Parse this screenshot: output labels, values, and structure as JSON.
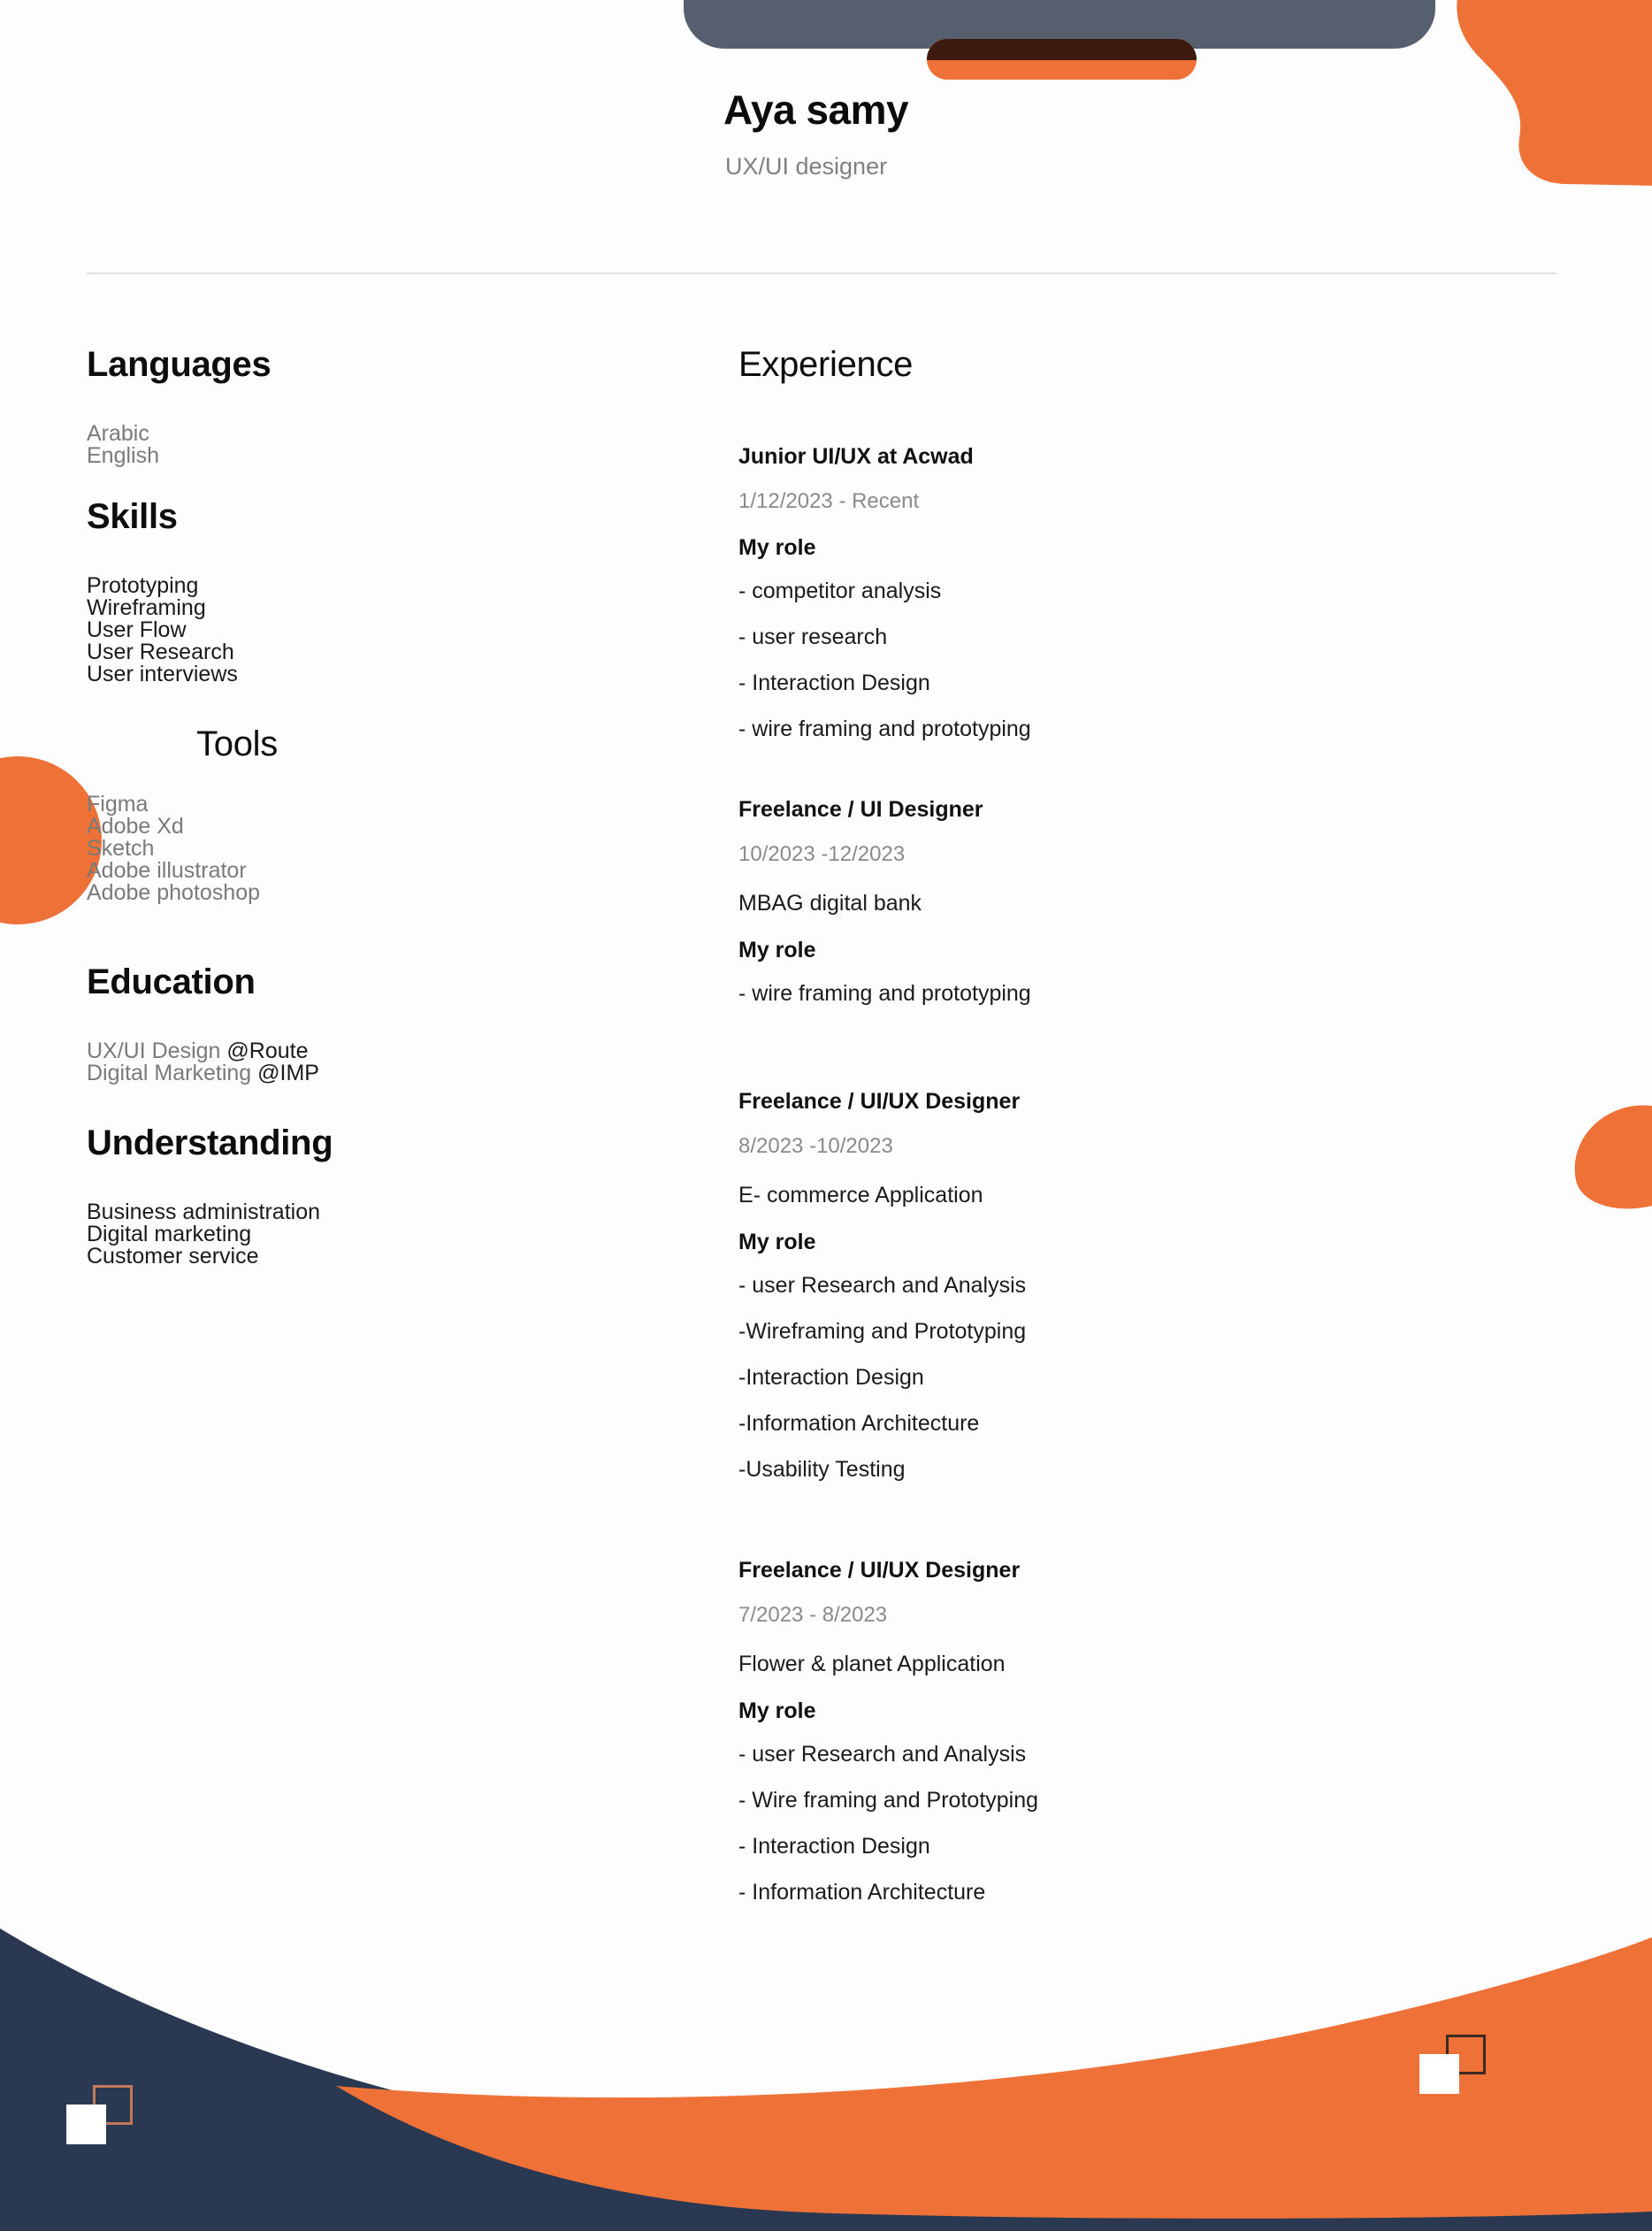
{
  "theme": {
    "orange": "#EE7137",
    "navy": "#2A3852",
    "gray": "#555F6E",
    "overlap_dark": "#3D1C0F",
    "muted_text": "#7a7a7a",
    "dark_text": "#1b1b1b"
  },
  "header": {
    "name": "Aya samy",
    "role": "UX/UI designer"
  },
  "left": {
    "languages": {
      "title": "Languages",
      "items": [
        "Arabic",
        "English"
      ]
    },
    "skills": {
      "title": "Skills",
      "items": [
        "Prototyping",
        "Wireframing",
        "User Flow",
        "User Research",
        "User interviews"
      ]
    },
    "tools": {
      "title": "Tools",
      "items": [
        "Figma",
        "Adobe Xd",
        "Sketch",
        "Adobe illustrator",
        "Adobe photoshop"
      ]
    },
    "education": {
      "title": "Education",
      "items": [
        {
          "program": "UX/UI Design ",
          "school": "@Route"
        },
        {
          "program": "Digital Marketing ",
          "school": "@IMP"
        }
      ]
    },
    "understanding": {
      "title": "Understanding",
      "items": [
        "Business administration",
        "Digital marketing",
        "Customer service"
      ]
    }
  },
  "right": {
    "experience": {
      "title": "Experience",
      "my_role_label": "My role",
      "entries": [
        {
          "position": "Junior UI/UX at Acwad",
          "date": "1/12/2023 - Recent",
          "project": "",
          "bullets": [
            "- competitor analysis",
            "- user research",
            "- Interaction Design",
            "- wire framing and prototyping"
          ]
        },
        {
          "position": "Freelance / UI Designer",
          "date": "10/2023 -12/2023",
          "project": "MBAG digital bank",
          "bullets": [
            "- wire framing and prototyping"
          ]
        },
        {
          "position": "Freelance / UI/UX Designer",
          "date": "8/2023 -10/2023",
          "project": "E- commerce Application",
          "bullets": [
            "- user Research and Analysis",
            "-Wireframing and Prototyping",
            "-Interaction Design",
            "-Information Architecture",
            "-Usability Testing"
          ]
        },
        {
          "position": "Freelance / UI/UX Designer",
          "date": "7/2023 - 8/2023",
          "project": "Flower & planet Application",
          "bullets": [
            "- user Research and Analysis",
            "- Wire framing and Prototyping",
            "- Interaction Design",
            "- Information Architecture"
          ]
        }
      ]
    }
  }
}
